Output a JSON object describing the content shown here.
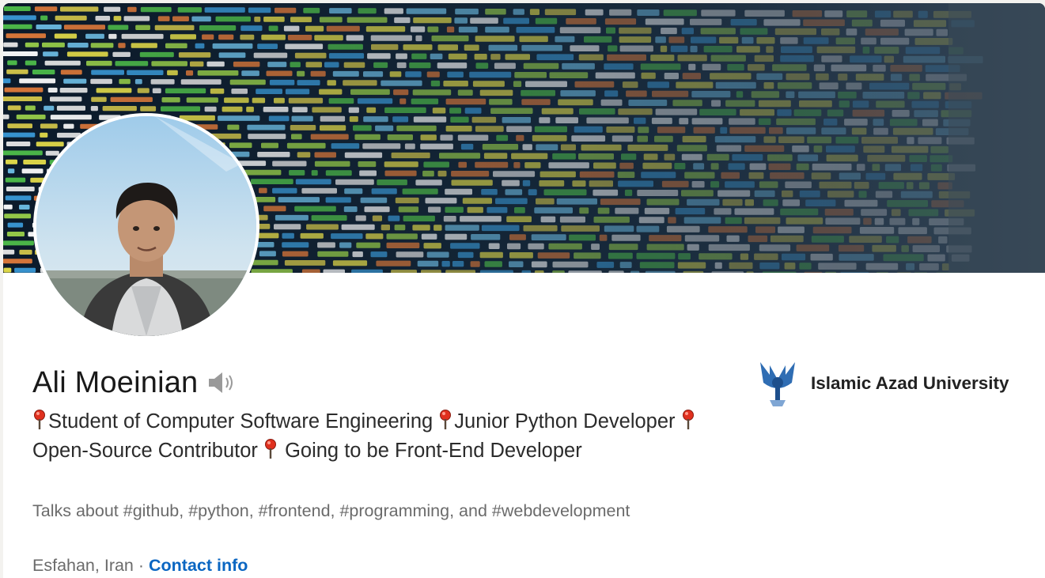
{
  "profile": {
    "name": "Ali Moeinian",
    "headline": [
      {
        "type": "pin"
      },
      {
        "type": "text",
        "value": "Student of Computer Software Engineering "
      },
      {
        "type": "pin"
      },
      {
        "type": "text",
        "value": "Junior Python Developer "
      },
      {
        "type": "pin"
      },
      {
        "type": "text",
        "value": "Open-Source Contributor "
      },
      {
        "type": "pin"
      },
      {
        "type": "text",
        "value": " Going to be Front-End Developer"
      }
    ],
    "talks_about": "Talks about #github, #python, #frontend, #programming, and #webdevelopment",
    "location": "Esfahan, Iran",
    "separator": " · ",
    "contact_label": "Contact info"
  },
  "education": {
    "name": "Islamic Azad University"
  },
  "icons": {
    "pronunciation": "speaker-icon",
    "headline_marker": "pushpin-icon",
    "education_logo": "university-logo-icon"
  },
  "colors": {
    "link": "#0a66c2",
    "pin_head": "#e0301e"
  }
}
